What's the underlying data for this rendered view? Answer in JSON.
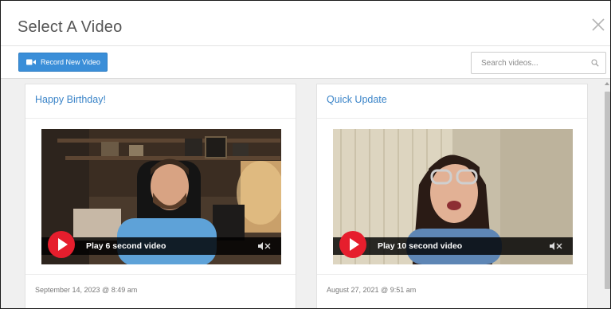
{
  "dialog": {
    "title": "Select A Video",
    "close_icon": "close-icon"
  },
  "toolbar": {
    "record_label": "Record New Video",
    "record_icon": "video-camera-icon",
    "search_placeholder": "Search videos...",
    "search_icon": "search-icon"
  },
  "videos": [
    {
      "title": "Happy Birthday!",
      "play_label": "Play 6 second video",
      "date": "September 14, 2023 @ 8:49 am",
      "mute_icon": "mute-icon"
    },
    {
      "title": "Quick Update",
      "play_label": "Play 10 second video",
      "date": "August 27, 2021 @ 9:51 am",
      "mute_icon": "mute-icon"
    }
  ],
  "colors": {
    "accent": "#3a8ed8",
    "link": "#3a84c8",
    "play": "#e61e2d"
  }
}
